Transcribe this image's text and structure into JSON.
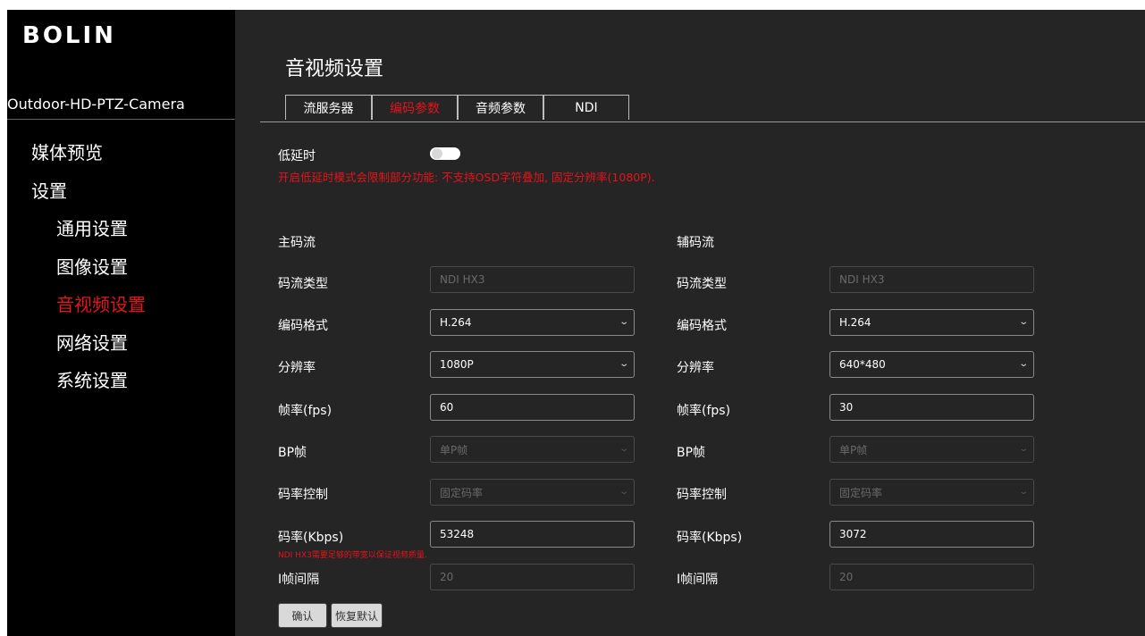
{
  "sidebar": {
    "logo": "BOLIN",
    "device_name": "Outdoor-HD-PTZ-Camera",
    "items": [
      {
        "label": "媒体预览"
      },
      {
        "label": "设置"
      },
      {
        "label": "通用设置"
      },
      {
        "label": "图像设置"
      },
      {
        "label": "音视频设置"
      },
      {
        "label": "网络设置"
      },
      {
        "label": "系统设置"
      }
    ]
  },
  "main": {
    "title": "音视频设置",
    "tabs": [
      {
        "label": "流服务器"
      },
      {
        "label": "编码参数"
      },
      {
        "label": "音频参数"
      },
      {
        "label": "NDI"
      }
    ],
    "low_latency": {
      "label": "低延时",
      "warning": "开启低延时模式会限制部分功能: 不支持OSD字符叠加, 固定分辨率(1080P)."
    },
    "main_stream": {
      "title": "主码流",
      "fields": [
        {
          "label": "码流类型",
          "value": "NDI HX3"
        },
        {
          "label": "编码格式",
          "value": "H.264"
        },
        {
          "label": "分辨率",
          "value": "1080P"
        },
        {
          "label": "帧率(fps)",
          "value": "60"
        },
        {
          "label": "BP帧",
          "value": "单P帧"
        },
        {
          "label": "码率控制",
          "value": "固定码率"
        },
        {
          "label": "码率(Kbps)",
          "value": "53248"
        },
        {
          "label": "I帧间隔",
          "value": "20"
        }
      ],
      "bitrate_hint": "NDI HX3需要足够的带宽以保证视频质量."
    },
    "sub_stream": {
      "title": "辅码流",
      "fields": [
        {
          "label": "码流类型",
          "value": "NDI HX3"
        },
        {
          "label": "编码格式",
          "value": "H.264"
        },
        {
          "label": "分辨率",
          "value": "640*480"
        },
        {
          "label": "帧率(fps)",
          "value": "30"
        },
        {
          "label": "BP帧",
          "value": "单P帧"
        },
        {
          "label": "码率控制",
          "value": "固定码率"
        },
        {
          "label": "码率(Kbps)",
          "value": "3072"
        },
        {
          "label": "I帧间隔",
          "value": "20"
        }
      ]
    },
    "buttons": {
      "confirm": "确认",
      "restore_default": "恢复默认"
    }
  }
}
